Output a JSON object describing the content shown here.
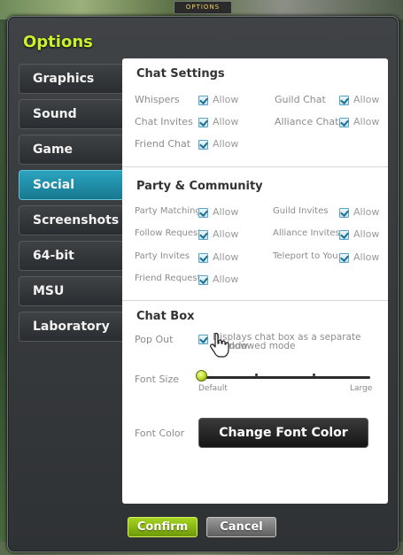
{
  "header": {
    "overlay_tag": "OPTIONS",
    "title": "Options"
  },
  "tabs": [
    {
      "label": "Graphics",
      "active": false
    },
    {
      "label": "Sound",
      "active": false
    },
    {
      "label": "Game",
      "active": false
    },
    {
      "label": "Social",
      "active": true
    },
    {
      "label": "Screenshots",
      "active": false
    },
    {
      "label": "64-bit",
      "active": false
    },
    {
      "label": "MSU",
      "active": false
    },
    {
      "label": "Laboratory",
      "active": false
    }
  ],
  "chat_settings": {
    "title": "Chat Settings",
    "items": [
      {
        "label": "Whispers",
        "value": "Allow",
        "checked": true
      },
      {
        "label": "Guild Chat",
        "value": "Allow",
        "checked": true
      },
      {
        "label": "Chat Invites",
        "value": "Allow",
        "checked": true
      },
      {
        "label": "Alliance Chat",
        "value": "Allow",
        "checked": true
      },
      {
        "label": "Friend Chat",
        "value": "Allow",
        "checked": true
      }
    ]
  },
  "party_community": {
    "title": "Party & Community",
    "items": [
      {
        "label": "Party Matching",
        "value": "Allow",
        "checked": true
      },
      {
        "label": "Guild Invites",
        "value": "Allow",
        "checked": true
      },
      {
        "label": "Follow Requests",
        "value": "Allow",
        "checked": true
      },
      {
        "label": "Alliance Invites",
        "value": "Allow",
        "checked": true
      },
      {
        "label": "Party Invites",
        "value": "Allow",
        "checked": true
      },
      {
        "label": "Teleport to You",
        "value": "Allow",
        "checked": true
      },
      {
        "label": "Friend Requests",
        "value": "Allow",
        "checked": true
      }
    ]
  },
  "chat_box": {
    "title": "Chat Box",
    "pop_out_label": "Pop Out",
    "pop_out_checked": true,
    "pop_out_desc_line1": "Displays chat box as a separate window",
    "pop_out_desc_line2": "indowed mode",
    "font_size_label": "Font Size",
    "font_size_min": "Default",
    "font_size_max": "Large",
    "font_size_value": 0,
    "font_color_label": "Font Color",
    "font_color_button": "Change Font Color"
  },
  "footer": {
    "confirm": "Confirm",
    "cancel": "Cancel"
  },
  "colors": {
    "title": "#c9f22a",
    "active_tab": "#2ba3bf",
    "confirm": "#8cc01a"
  }
}
